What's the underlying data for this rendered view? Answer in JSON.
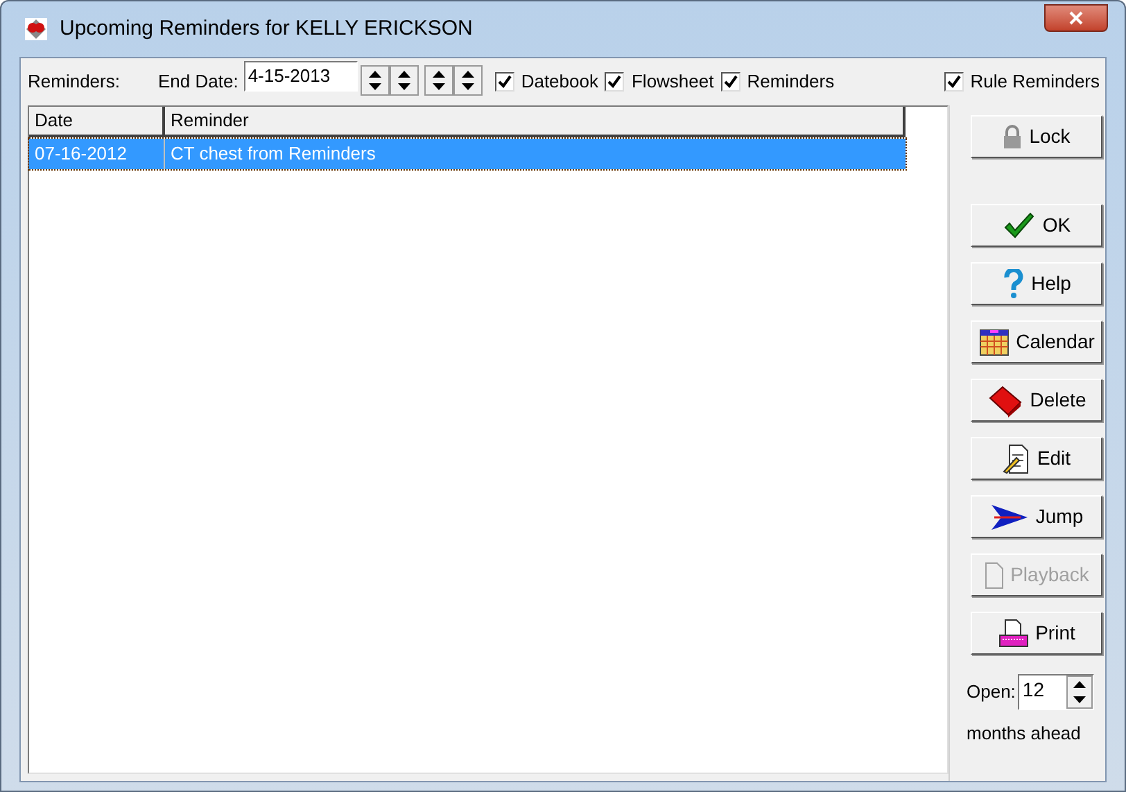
{
  "window": {
    "title": "Upcoming Reminders for KELLY ERICKSON"
  },
  "toolbar": {
    "reminders_label": "Reminders:",
    "end_date_label": "End Date:",
    "end_date": "4-15-2013",
    "checkboxes": [
      {
        "label": "Datebook",
        "checked": true
      },
      {
        "label": "Flowsheet",
        "checked": true
      },
      {
        "label": "Reminders",
        "checked": true
      },
      {
        "label": "Rule Reminders",
        "checked": true
      }
    ]
  },
  "table": {
    "columns": [
      "Date",
      "Reminder"
    ],
    "rows": [
      {
        "date": "07-16-2012",
        "reminder": "CT chest from Reminders",
        "selected": true
      }
    ]
  },
  "buttons": [
    {
      "kind": "lock",
      "label": "Lock",
      "disabled": false
    },
    {
      "kind": "ok",
      "label": "OK",
      "disabled": false
    },
    {
      "kind": "help",
      "label": "Help",
      "disabled": false
    },
    {
      "kind": "calendar",
      "label": "Calendar",
      "disabled": false
    },
    {
      "kind": "delete",
      "label": "Delete",
      "disabled": false
    },
    {
      "kind": "edit",
      "label": "Edit",
      "disabled": false
    },
    {
      "kind": "jump",
      "label": "Jump",
      "disabled": false
    },
    {
      "kind": "playback",
      "label": "Playback",
      "disabled": true
    },
    {
      "kind": "print",
      "label": "Print",
      "disabled": false
    }
  ],
  "open": {
    "label": "Open:",
    "value": "12",
    "suffix": "months ahead"
  }
}
